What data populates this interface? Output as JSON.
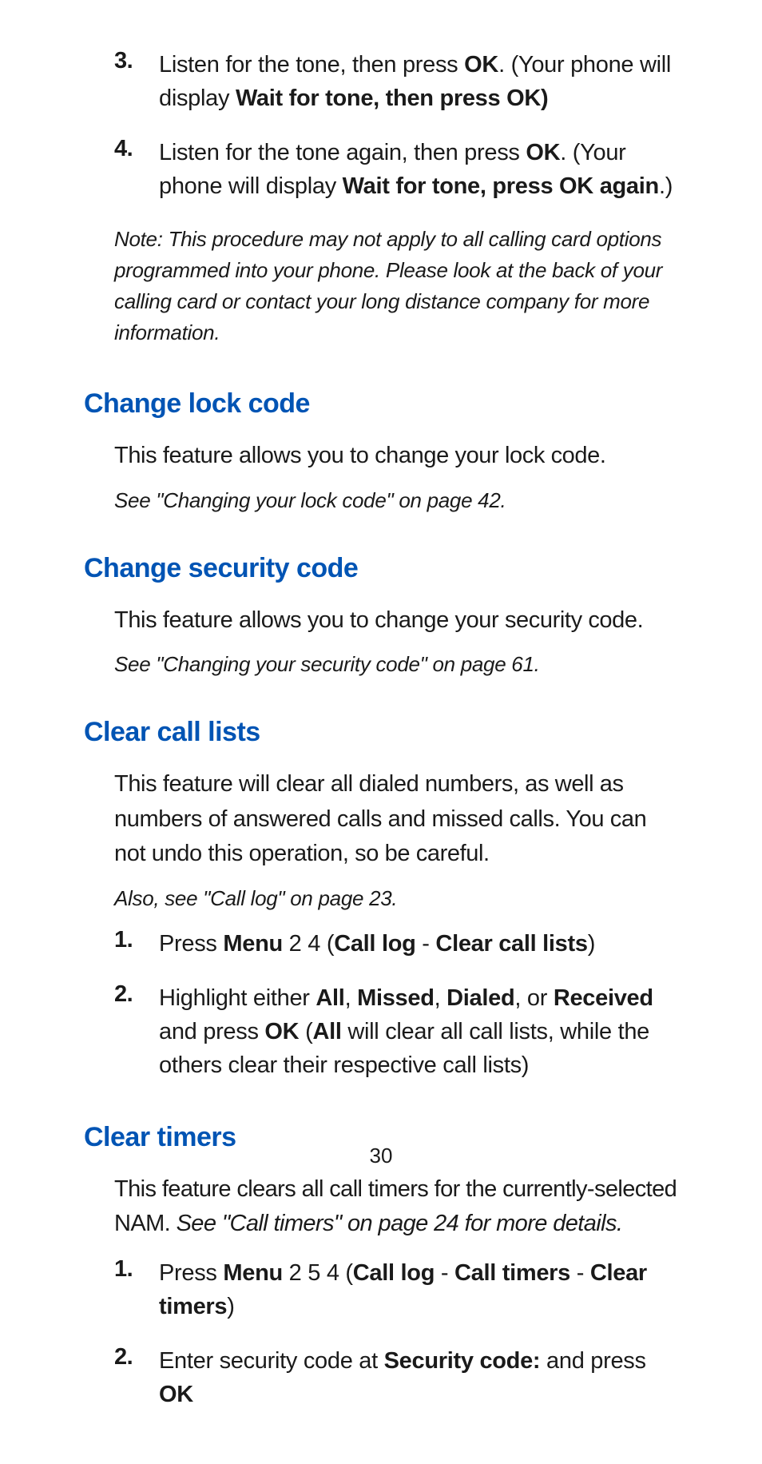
{
  "top_list": [
    {
      "num": "3.",
      "segments": [
        {
          "t": "Listen for the tone, then press "
        },
        {
          "t": "OK",
          "b": true
        },
        {
          "t": ". (Your phone will display "
        },
        {
          "t": "Wait for tone, then press OK)",
          "b": true
        }
      ]
    },
    {
      "num": "4.",
      "segments": [
        {
          "t": "Listen for the tone again, then press "
        },
        {
          "t": "OK",
          "b": true
        },
        {
          "t": ". (Your phone will display "
        },
        {
          "t": "Wait for tone, press OK again",
          "b": true
        },
        {
          "t": ".)"
        }
      ]
    }
  ],
  "top_note": "Note: This procedure may not apply to all calling card options programmed into your phone. Please look at the back of your calling card or contact your long distance company for more information.",
  "sections": {
    "change_lock": {
      "heading": "Change lock code",
      "body": "This feature allows you to change your lock code.",
      "ref": "See \"Changing your lock code\" on page 42."
    },
    "change_security": {
      "heading": "Change security code",
      "body": "This feature allows you to change your security code.",
      "ref": "See \"Changing your security code\" on page 61."
    },
    "clear_call_lists": {
      "heading": "Clear call lists",
      "body": "This feature will clear all dialed numbers, as well as numbers of answered calls and missed calls. You can not undo this operation, so be careful.",
      "ref": "Also, see \"Call log\" on page 23.",
      "list": [
        {
          "num": "1.",
          "segments": [
            {
              "t": "Press "
            },
            {
              "t": "Menu",
              "b": true
            },
            {
              "t": " 2 4 ("
            },
            {
              "t": "Call log",
              "b": true
            },
            {
              "t": " - "
            },
            {
              "t": "Clear call lists",
              "b": true
            },
            {
              "t": ")"
            }
          ]
        },
        {
          "num": "2.",
          "segments": [
            {
              "t": "Highlight either "
            },
            {
              "t": "All",
              "b": true
            },
            {
              "t": ", "
            },
            {
              "t": "Missed",
              "b": true
            },
            {
              "t": ", "
            },
            {
              "t": "Dialed",
              "b": true
            },
            {
              "t": ", or "
            },
            {
              "t": "Received",
              "b": true
            },
            {
              "t": " and press "
            },
            {
              "t": "OK",
              "b": true
            },
            {
              "t": " ("
            },
            {
              "t": "All",
              "b": true
            },
            {
              "t": " will clear all call lists, while the others clear their respective call lists)"
            }
          ]
        }
      ]
    },
    "clear_timers": {
      "heading": "Clear timers",
      "body_segments": [
        {
          "t": "This feature clears all call timers for the currently-selected NAM. "
        },
        {
          "t": "See \"Call timers\" on page 24 for more details.",
          "i": true
        }
      ],
      "list": [
        {
          "num": "1.",
          "segments": [
            {
              "t": "Press "
            },
            {
              "t": "Menu",
              "b": true
            },
            {
              "t": " 2 5 4 ("
            },
            {
              "t": "Call log",
              "b": true
            },
            {
              "t": " - "
            },
            {
              "t": "Call timers",
              "b": true
            },
            {
              "t": " - "
            },
            {
              "t": "Clear timers",
              "b": true
            },
            {
              "t": ")"
            }
          ]
        },
        {
          "num": "2.",
          "segments": [
            {
              "t": "Enter security code at "
            },
            {
              "t": "Security code:",
              "b": true
            },
            {
              "t": " and press "
            },
            {
              "t": "OK",
              "b": true
            }
          ]
        }
      ]
    }
  },
  "page_number": "30"
}
